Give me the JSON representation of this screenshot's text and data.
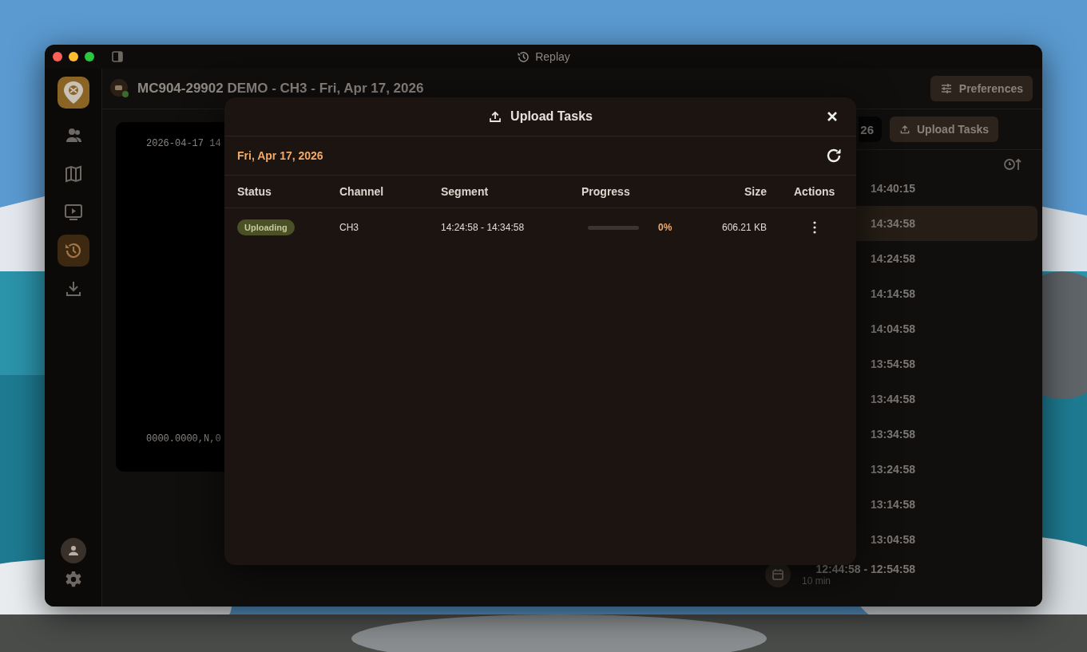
{
  "window": {
    "title": "Replay"
  },
  "rail": {
    "items": [
      {
        "kind": "people",
        "selected": false
      },
      {
        "kind": "map",
        "selected": false
      },
      {
        "kind": "player",
        "selected": false
      },
      {
        "kind": "history",
        "selected": true
      },
      {
        "kind": "download",
        "selected": false
      }
    ]
  },
  "header": {
    "title": "MC904-29902 DEMO - CH3 - Fri, Apr 17, 2026",
    "preferences": "Preferences"
  },
  "video": {
    "overlay_top": "2026-04-17 14",
    "overlay_bottom": "0000.0000,N,0"
  },
  "toolbar": {
    "date": "26",
    "upload": "Upload Tasks"
  },
  "segments": [
    {
      "time": "14:40:15",
      "selected": false
    },
    {
      "time": "14:34:58",
      "selected": true
    },
    {
      "time": "14:24:58",
      "selected": false
    },
    {
      "time": "14:14:58",
      "selected": false
    },
    {
      "time": "14:04:58",
      "selected": false
    },
    {
      "time": "13:54:58",
      "selected": false
    },
    {
      "time": "13:44:58",
      "selected": false
    },
    {
      "time": "13:34:58",
      "selected": false
    },
    {
      "time": "13:24:58",
      "selected": false
    },
    {
      "time": "13:14:58",
      "selected": false
    },
    {
      "time": "13:04:58",
      "selected": false
    },
    {
      "time": "12:44:58 - 12:54:58",
      "duration": "10 min",
      "selected": false
    }
  ],
  "dialog": {
    "title": "Upload Tasks",
    "date": "Fri, Apr 17, 2026",
    "columns": [
      "Status",
      "Channel",
      "Segment",
      "Progress",
      "Size",
      "Actions"
    ],
    "rows": [
      {
        "status": "Uploading",
        "kind": "uploading",
        "channel": "CH3",
        "segment": "14:24:58 - 14:34:58",
        "level": 0,
        "progress": "0%",
        "size": "606.21 KB"
      }
    ]
  }
}
